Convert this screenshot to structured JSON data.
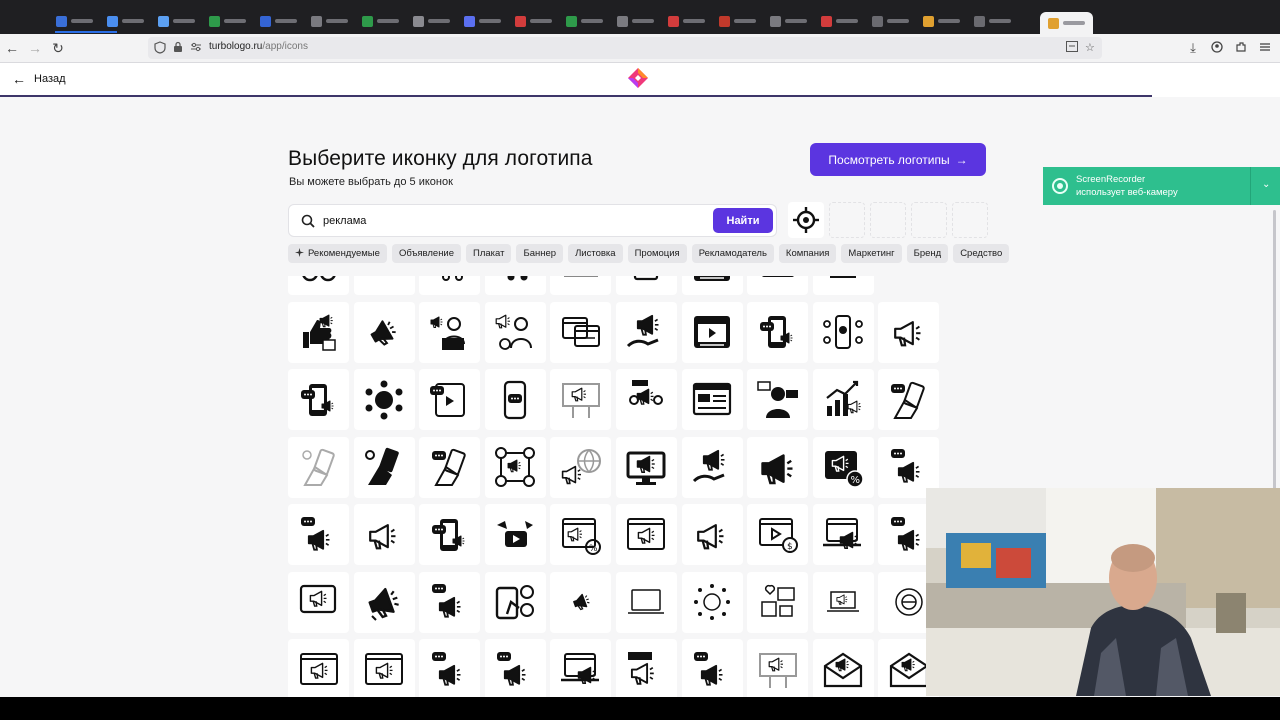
{
  "browser": {
    "url_host": "turbologo.ru",
    "url_path": "/app/icons"
  },
  "header": {
    "back_label": "Назад"
  },
  "main": {
    "title": "Выберите иконку для логотипа",
    "subtitle": "Вы можете выбрать до 5 иконок",
    "cta_label": "Посмотреть логотипы",
    "cta_arrow": "→"
  },
  "search": {
    "value": "реклама",
    "placeholder": "",
    "button_label": "Найти"
  },
  "chips": [
    {
      "label": "Рекомендуемые",
      "icon": "sparkle-icon"
    },
    {
      "label": "Объявление"
    },
    {
      "label": "Плакат"
    },
    {
      "label": "Баннер"
    },
    {
      "label": "Листовка"
    },
    {
      "label": "Промоция"
    },
    {
      "label": "Рекламодатель"
    },
    {
      "label": "Компания"
    },
    {
      "label": "Маркетинг"
    },
    {
      "label": "Бренд"
    },
    {
      "label": "Средство"
    }
  ],
  "icons": [
    "glasses-icon",
    "hand-card-icon",
    "cart-icon",
    "cart-dots-icon",
    "laptop-icon",
    "document-icon",
    "video-player-icon",
    "video-box-icon",
    "box-heart-icon",
    "empty",
    "thumbs-megaphone-icon",
    "megaphone-tilt-icon",
    "man-laptop-icon",
    "man-megaphone-icon",
    "browser-docs-icon",
    "hand-megaphone-icon",
    "video-player-icon",
    "phone-chat-icon",
    "phone-network-icon",
    "megaphone-outline-icon",
    "phone-chat-icon",
    "network-megaphone-icon",
    "tablet-video-icon",
    "phone-message-icon",
    "billboard-icon",
    "people-megaphone-icon",
    "ads-browser-icon",
    "man-ads-icon",
    "growth-chart-icon",
    "hand-phone-icon",
    "hand-phone-light-icon",
    "hand-social-icon",
    "hand-phone-icon",
    "people-network-icon",
    "globe-megaphone-icon",
    "monitor-megaphone-icon",
    "hand-megaphone-icon",
    "megaphone-solid-icon",
    "megaphone-percent-icon",
    "chat-megaphone-icon",
    "chat-megaphone-icon",
    "megaphone-outline-icon",
    "phone-chat-icon",
    "video-fly-icon",
    "browser-percent-icon",
    "browser-megaphone-icon",
    "megaphone-outline-icon",
    "video-dollar-icon",
    "laptop-megaphone-icon",
    "chat-megaphone-icon",
    "frame-megaphone-icon",
    "megaphone-burst-icon",
    "chat-megaphone-icon",
    "phone-dollar-icon",
    "megaphone-small-icon",
    "laptop-outline-icon",
    "virus-network-icon",
    "social-heart-icon",
    "laptop-small-icon",
    "globe-badge-icon",
    "browser-megaphone-icon",
    "browser-megaphone-icon",
    "chat-megaphone-icon",
    "chat-megaphone-icon",
    "laptop-megaphone-icon",
    "sign-megaphone-icon",
    "chat-megaphone-icon",
    "billboard-icon",
    "envelope-icon",
    "envelope-icon"
  ],
  "notification": {
    "title": "ScreenRecorder",
    "text": "использует веб-камеру"
  }
}
